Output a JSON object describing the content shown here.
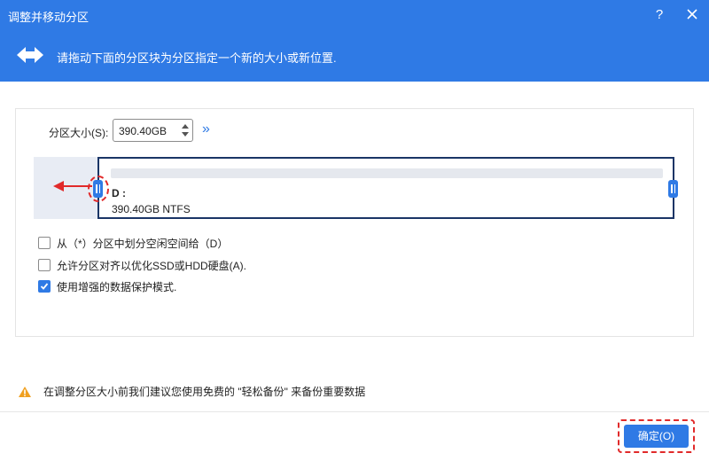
{
  "window": {
    "title": "调整并移动分区",
    "help_label": "?"
  },
  "header": {
    "instruction": "请拖动下面的分区块为分区指定一个新的大小或新位置."
  },
  "size": {
    "label": "分区大小(S):",
    "value": "390.40GB",
    "expand_glyph": "»"
  },
  "partition": {
    "drive": "D :",
    "info": "390.40GB NTFS"
  },
  "options": [
    {
      "label": "从（*）分区中划分空闲空间给（D）",
      "checked": false
    },
    {
      "label": "允许分区对齐以优化SSD或HDD硬盘(A).",
      "checked": false
    },
    {
      "label": "使用增强的数据保护模式.",
      "checked": true
    }
  ],
  "warning": {
    "text": "在调整分区大小前我们建议您使用免费的 \"轻松备份\" 来备份重要数据"
  },
  "footer": {
    "ok_label": "确定(O)"
  },
  "colors": {
    "accent": "#2f7ae5",
    "annotation": "#e12a2a",
    "partition_border": "#1a3566",
    "warning": "#f0a020"
  }
}
